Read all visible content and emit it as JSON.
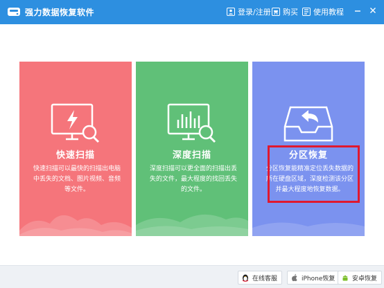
{
  "app": {
    "title": "强力数据恢复软件"
  },
  "header": {
    "login_label": "登录/注册",
    "buy_label": "购买",
    "tutorial_label": "使用教程"
  },
  "cards": [
    {
      "title": "快速扫描",
      "desc": "快速扫描可以最快的扫描出电脑中丢失的文档、图片视频、音频等文件。",
      "color": "#f5757b"
    },
    {
      "title": "深度扫描",
      "desc": "深度扫描可以更全面的扫描出丢失的文件，最大程度的找回丢失的文件。",
      "color": "#60c078"
    },
    {
      "title": "分区恢复",
      "desc": "分区恢复能精准定位丢失数据的所在硬盘区域，深度检测该分区并最大程度地恢复数据。",
      "color": "#7b92ef"
    }
  ],
  "footer": {
    "online_service_label": "在线客服",
    "iphone_recovery_label": "iPhone恢复",
    "android_recovery_label": "安卓恢复"
  },
  "colors": {
    "titlebar": "#2d8fe0",
    "highlight": "#e0182f"
  }
}
